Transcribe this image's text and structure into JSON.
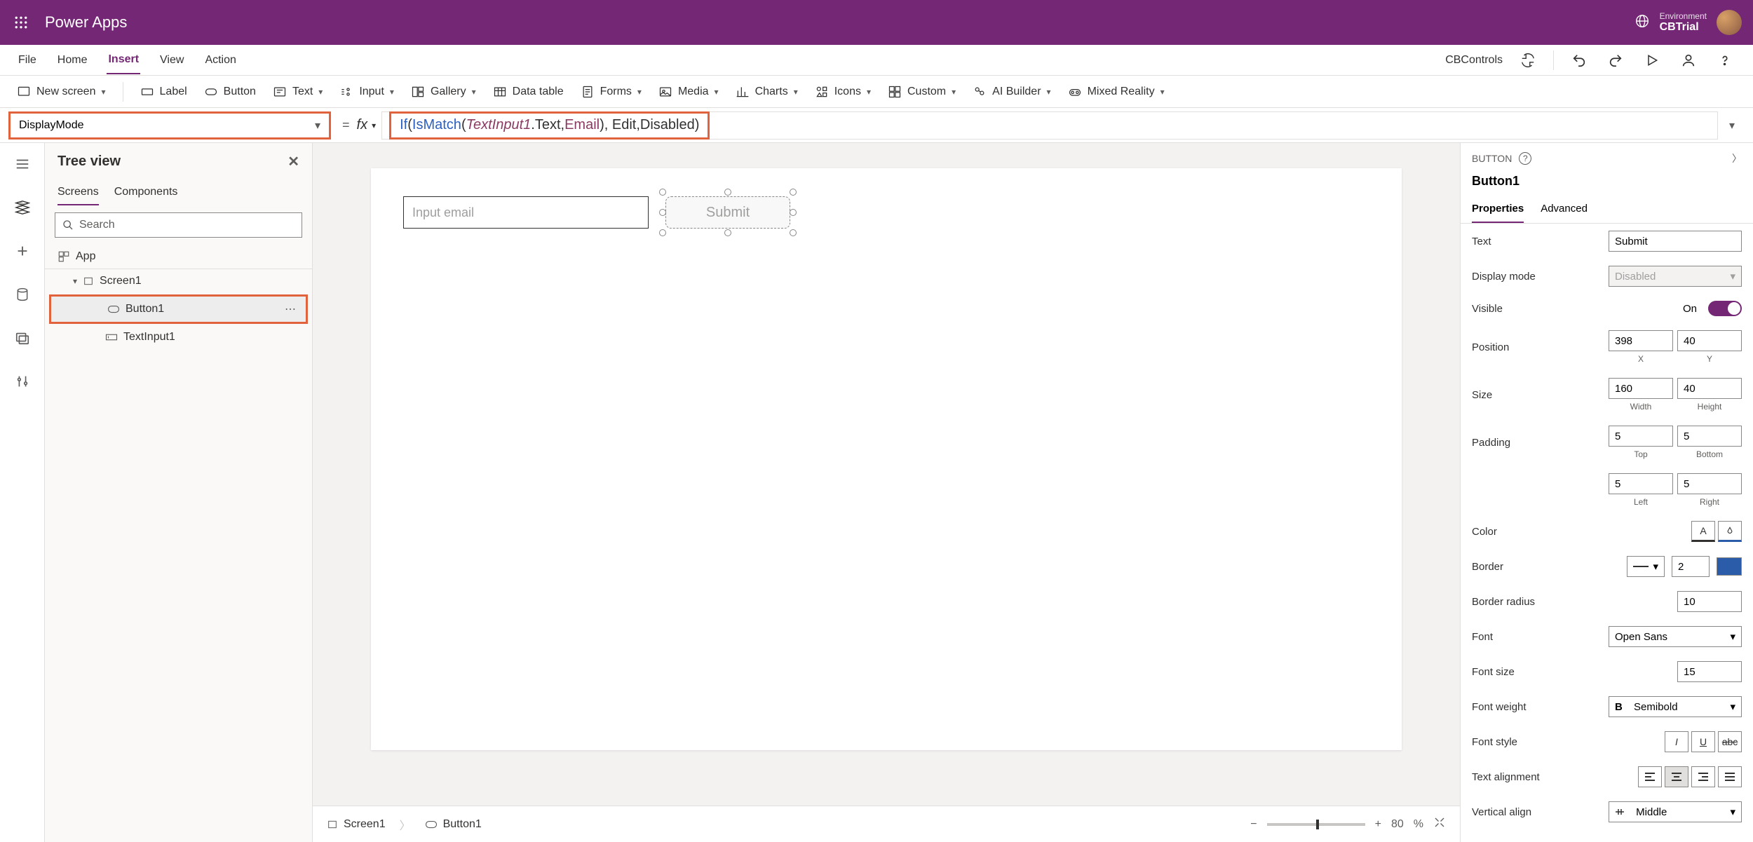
{
  "header": {
    "appTitle": "Power Apps",
    "envLabel": "Environment",
    "envName": "CBTrial"
  },
  "menu": {
    "items": [
      "File",
      "Home",
      "Insert",
      "View",
      "Action"
    ],
    "activeIndex": 2,
    "controlsSet": "CBControls"
  },
  "ribbon": {
    "newScreen": "New screen",
    "label": "Label",
    "button": "Button",
    "text": "Text",
    "input": "Input",
    "gallery": "Gallery",
    "dataTable": "Data table",
    "forms": "Forms",
    "media": "Media",
    "charts": "Charts",
    "icons": "Icons",
    "custom": "Custom",
    "aiBuilder": "AI Builder",
    "mixedReality": "Mixed Reality"
  },
  "formula": {
    "property": "DisplayMode",
    "fx": "fx",
    "tokens": {
      "ifKw": "If",
      "isMatch": "IsMatch",
      "obj": "TextInput1",
      "dotText": ".Text, ",
      "email": "Email",
      "rest": "), Edit,Disabled)"
    }
  },
  "tree": {
    "title": "Tree view",
    "tabs": {
      "screens": "Screens",
      "components": "Components"
    },
    "searchPlaceholder": "Search",
    "app": "App",
    "screen1": "Screen1",
    "button1": "Button1",
    "textInput1": "TextInput1"
  },
  "canvas": {
    "emailPlaceholder": "Input email",
    "submit": "Submit"
  },
  "footer": {
    "screen": "Screen1",
    "button": "Button1",
    "zoom": "80",
    "zoomPct": "%"
  },
  "props": {
    "type": "BUTTON",
    "name": "Button1",
    "tabs": {
      "properties": "Properties",
      "advanced": "Advanced"
    },
    "text": {
      "label": "Text",
      "value": "Submit"
    },
    "displayMode": {
      "label": "Display mode",
      "value": "Disabled"
    },
    "visible": {
      "label": "Visible",
      "state": "On"
    },
    "position": {
      "label": "Position",
      "x": "398",
      "y": "40",
      "xl": "X",
      "yl": "Y"
    },
    "size": {
      "label": "Size",
      "w": "160",
      "h": "40",
      "wl": "Width",
      "hl": "Height"
    },
    "padding": {
      "label": "Padding",
      "top": "5",
      "bottom": "5",
      "left": "5",
      "right": "5",
      "tl": "Top",
      "bl": "Bottom",
      "ll": "Left",
      "rl": "Right"
    },
    "color": {
      "label": "Color"
    },
    "border": {
      "label": "Border",
      "value": "2"
    },
    "borderRadius": {
      "label": "Border radius",
      "value": "10"
    },
    "font": {
      "label": "Font",
      "value": "Open Sans"
    },
    "fontSize": {
      "label": "Font size",
      "value": "15"
    },
    "fontWeight": {
      "label": "Font weight",
      "value": "Semibold"
    },
    "fontStyle": {
      "label": "Font style"
    },
    "textAlign": {
      "label": "Text alignment"
    },
    "vAlign": {
      "label": "Vertical align",
      "value": "Middle"
    }
  }
}
